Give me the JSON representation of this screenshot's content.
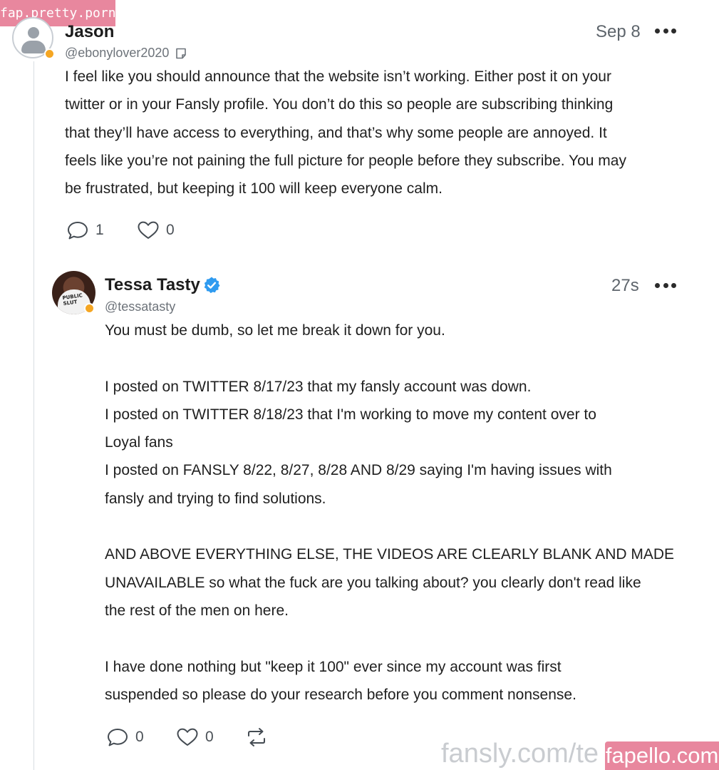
{
  "watermarks": {
    "top": "fap.pretty.porn",
    "bottom_url": "fansly.com/te",
    "bottom_badge": "fapello.com"
  },
  "post": {
    "author_name": "Jason",
    "handle": "@ebonylover2020",
    "timestamp": "Sep 8",
    "paragraphs": [
      "I feel like you should announce that the website isn’t working. Either post it on your",
      "twitter or in your Fansly profile. You don’t do this so people are subscribing thinking",
      "that they’ll have access to everything, and that’s why some people are annoyed. It",
      "feels like you’re not paining the full picture for people before they subscribe. You may",
      "be frustrated, but keeping it 100 will keep everyone calm."
    ],
    "reply_count": "1",
    "like_count": "0",
    "status_color": "#f5a623"
  },
  "reply": {
    "author_name": "Tessa Tasty",
    "handle": "@tessatasty",
    "timestamp": "27s",
    "avatar_shirt_text": "PUBLIC SLUT",
    "lines": [
      "You must be dumb, so let me break it down for you.",
      "",
      "I posted on TWITTER 8/17/23 that my fansly account was down.",
      "I posted on TWITTER 8/18/23 that I'm working to move my content over to",
      "Loyal fans",
      "I posted on FANSLY 8/22, 8/27, 8/28 AND 8/29 saying I'm having issues with",
      "fansly and trying to find solutions.",
      "",
      "AND ABOVE EVERYTHING ELSE, THE VIDEOS ARE CLEARLY BLANK AND MADE",
      "UNAVAILABLE so what the fuck are you talking about? you clearly don't read like",
      "the rest of the men on here.",
      "",
      "I have done nothing but \"keep it 100\" ever since my account was first",
      "suspended so please do your research before you comment nonsense."
    ],
    "reply_count": "0",
    "like_count": "0",
    "verified_color": "#2f9bf0",
    "status_color": "#f5a623"
  },
  "icons": {
    "comment": "comment-icon",
    "like": "heart-icon",
    "repost": "repost-icon",
    "more": "more-icon",
    "note": "note-icon",
    "verified": "verified-badge-icon"
  }
}
